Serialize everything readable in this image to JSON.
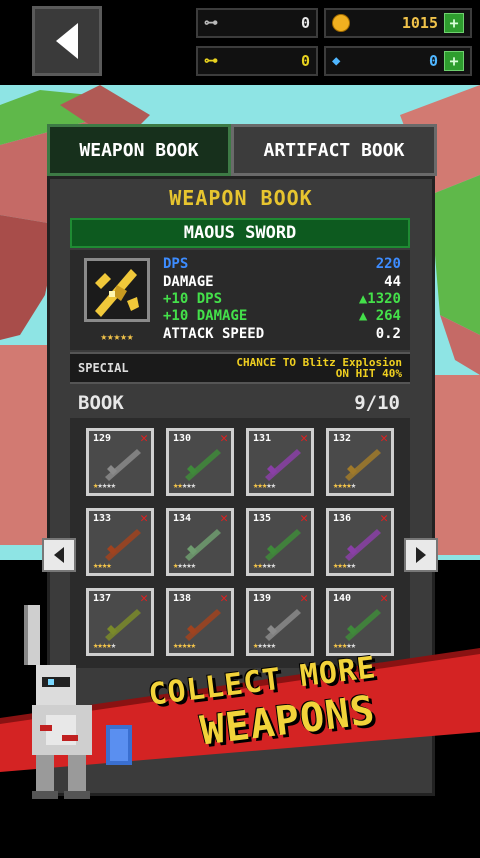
{
  "top": {
    "keys_silver": "0",
    "gold": "1015",
    "keys_gold": "0",
    "gems": "0",
    "plus_label": "+"
  },
  "tabs": {
    "weapon": "WEAPON BOOK",
    "artifact": "ARTIFACT BOOK"
  },
  "panel": {
    "title": "WEAPON BOOK",
    "weapon_name": "MAOUS SWORD",
    "main_stars": "★★★★★",
    "stats": [
      {
        "label": "DPS",
        "value": "220"
      },
      {
        "label": "DAMAGE",
        "value": "44"
      },
      {
        "label": "+10 DPS",
        "value": "▲1320"
      },
      {
        "label": "+10 DAMAGE",
        "value": "▲ 264"
      },
      {
        "label": "ATTACK SPEED",
        "value": "0.2"
      }
    ],
    "special_label": "SPECIAL",
    "special_text_1": "CHANCE TO Blitz Explosion",
    "special_text_2": "ON HIT 40%",
    "book_label": "BOOK",
    "book_count": "9/10"
  },
  "cards": [
    {
      "num": "129",
      "stars_filled": "★",
      "stars_empty": "★★★★",
      "color": "#8a8a8a"
    },
    {
      "num": "130",
      "stars_filled": "★★",
      "stars_empty": "★★★",
      "color": "#3f8a3a"
    },
    {
      "num": "131",
      "stars_filled": "★★★",
      "stars_empty": "★★",
      "color": "#8a3fa6"
    },
    {
      "num": "132",
      "stars_filled": "★★★★",
      "stars_empty": "★",
      "color": "#a07a2a"
    },
    {
      "num": "133",
      "stars_filled": "★★★★",
      "stars_empty": "",
      "color": "#a0431f"
    },
    {
      "num": "134",
      "stars_filled": "★",
      "stars_empty": "★★★★",
      "color": "#6f9c6f"
    },
    {
      "num": "135",
      "stars_filled": "★★",
      "stars_empty": "★★★",
      "color": "#3f8a3a"
    },
    {
      "num": "136",
      "stars_filled": "★★★",
      "stars_empty": "★★",
      "color": "#8a3fa6"
    },
    {
      "num": "137",
      "stars_filled": "★★★★",
      "stars_empty": "★",
      "color": "#7a8a2a"
    },
    {
      "num": "138",
      "stars_filled": "★★★★★",
      "stars_empty": "",
      "color": "#a0431f"
    },
    {
      "num": "139",
      "stars_filled": "★",
      "stars_empty": "★★★★",
      "color": "#8a8a8a"
    },
    {
      "num": "140",
      "stars_filled": "★★★",
      "stars_empty": "★★",
      "color": "#3f8a3a"
    }
  ],
  "banner": {
    "line1": "COLLECT MORE",
    "line2": "WEAPONS"
  },
  "colors": {
    "gold_text": "#e7c52f",
    "dps_blue": "#3d8cff",
    "bonus_green": "#44e04a",
    "banner_red": "#d42323"
  }
}
